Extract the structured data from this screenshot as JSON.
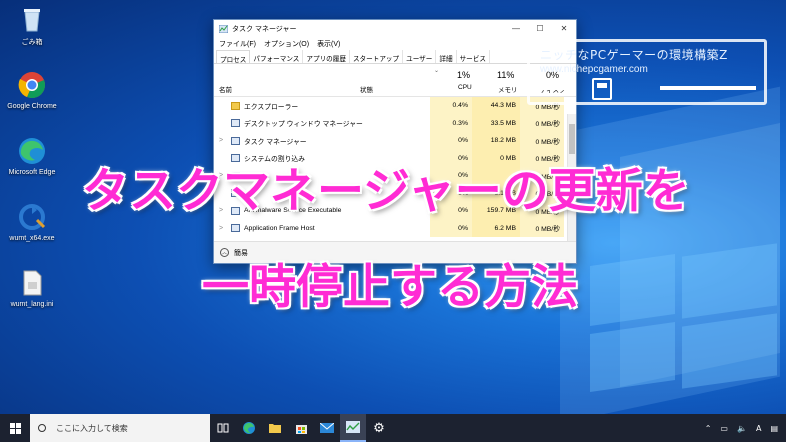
{
  "desktop": {
    "icons": [
      {
        "label": "ごみ箱",
        "icon": "recycle-bin-icon"
      },
      {
        "label": "Google Chrome",
        "icon": "chrome-icon"
      },
      {
        "label": "Microsoft Edge",
        "icon": "edge-icon"
      },
      {
        "label": "wumt_x64.exe",
        "icon": "wumt-icon"
      },
      {
        "label": "wumt_lang.ini",
        "icon": "ini-file-icon"
      }
    ]
  },
  "task_manager": {
    "title": "タスク マネージャー",
    "menu": [
      "ファイル(F)",
      "オプション(O)",
      "表示(V)"
    ],
    "tabs": [
      "プロセス",
      "パフォーマンス",
      "アプリの履歴",
      "スタートアップ",
      "ユーザー",
      "詳細",
      "サービス"
    ],
    "columns": {
      "name": "名前",
      "status": "状態",
      "cpu_pct": "1%",
      "cpu": "CPU",
      "mem_pct": "11%",
      "mem": "メモリ",
      "disk_pct": "0%",
      "disk": "ディスク"
    },
    "rows": [
      {
        "expand": "",
        "name": "エクスプローラー",
        "cpu": "0.4%",
        "mem": "44.3 MB",
        "disk": "0 MB/秒"
      },
      {
        "expand": "",
        "name": "デスクトップ ウィンドウ マネージャー",
        "cpu": "0.3%",
        "mem": "33.5 MB",
        "disk": "0 MB/秒"
      },
      {
        "expand": ">",
        "name": "タスク マネージャー",
        "cpu": "0%",
        "mem": "18.2 MB",
        "disk": "0 MB/秒"
      },
      {
        "expand": "",
        "name": "システムの割り込み",
        "cpu": "0%",
        "mem": "0 MB",
        "disk": "0 MB/秒"
      },
      {
        "expand": ">",
        "name": "",
        "cpu": "0%",
        "mem": "",
        "disk": "0 MB/秒"
      },
      {
        "expand": "",
        "name": "",
        "cpu": "0%",
        "mem": "0.1 MB",
        "disk": "0 MB/秒"
      },
      {
        "expand": ">",
        "name": "Antimalware Service Executable",
        "cpu": "0%",
        "mem": "159.7 MB",
        "disk": "0 MB/秒"
      },
      {
        "expand": ">",
        "name": "Application Frame Host",
        "cpu": "0%",
        "mem": "6.2 MB",
        "disk": "0 MB/秒"
      }
    ],
    "footer": "簡易"
  },
  "logo": {
    "line1": "ニッチなPCゲーマーの環境構築Z",
    "line2": "www.nichepcgamer.com"
  },
  "headline": {
    "line1": "タスクマネージャーの更新を",
    "line2": "一時停止する方法"
  },
  "taskbar": {
    "search_placeholder": "ここに入力して検索"
  },
  "colors": {
    "headline": "#ff2bd4",
    "taskbar": "#1c2230",
    "cpu_cell": "#fdf3c6",
    "mem_cell": "#fdeeb0"
  }
}
